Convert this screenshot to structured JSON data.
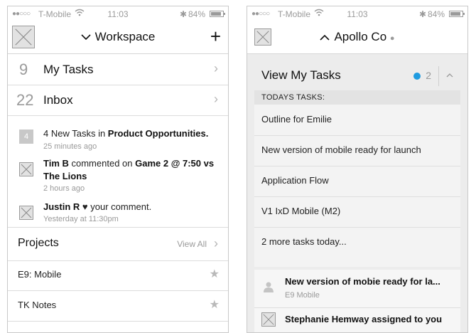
{
  "status": {
    "dots": "●●○○○",
    "carrier": "T-Mobile",
    "time": "11:03",
    "bluetooth": "✱",
    "battery": "84%"
  },
  "left": {
    "nav": {
      "title": "Workspace"
    },
    "rows": [
      {
        "count": "9",
        "label": "My Tasks"
      },
      {
        "count": "22",
        "label": "Inbox"
      }
    ],
    "feed": [
      {
        "badge": "4",
        "pre": "4 New Tasks in ",
        "bold": "Product Opportunities.",
        "sub": "25 minutes ago"
      },
      {
        "bold1": "Tim B",
        "mid": " commented on ",
        "bold2": "Game 2 @ 7:50 vs The Lions",
        "sub": "2 hours ago"
      },
      {
        "bold1": "Justin R",
        "heart": "♥",
        "post": " your comment.",
        "sub": "Yesterday at 11:30pm"
      }
    ],
    "projects": {
      "title": "Projects",
      "view_all": "View All",
      "items": [
        {
          "label": "E9: Mobile"
        },
        {
          "label": "TK Notes"
        }
      ]
    }
  },
  "right": {
    "nav": {
      "title": "Apollo Co",
      "dot": "●"
    },
    "card": {
      "title": "View My Tasks",
      "count": "2",
      "section": "TODAYS TASKS:",
      "tasks": [
        {
          "label": "Outline for Emilie"
        },
        {
          "label": "New version of mobile ready for launch"
        },
        {
          "label": "Application Flow"
        },
        {
          "label": "V1 IxD Mobile (M2)"
        },
        {
          "label": "2 more tasks today..."
        }
      ]
    },
    "notification": {
      "title": "New version of mobie ready for la...",
      "sub": "E9 Mobile",
      "next": "Stephanie Hemway assigned to you"
    }
  },
  "colors": {
    "accent": "#1e9be0",
    "divider": "#dcdcdc",
    "muted": "#9a9a9a"
  }
}
